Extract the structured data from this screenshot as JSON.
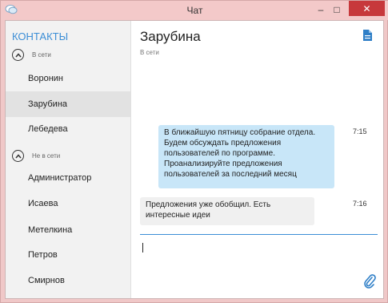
{
  "window": {
    "title": "Чат",
    "min_glyph": "–",
    "max_glyph": "□",
    "close_glyph": "✕"
  },
  "sidebar": {
    "title": "КОНТАКТЫ",
    "groups": [
      {
        "label": "В сети",
        "contacts": [
          "Воронин",
          "Зарубина",
          "Лебедева"
        ]
      },
      {
        "label": "Не в сети",
        "contacts": [
          "Администратор",
          "Исаева",
          "Метелкина",
          "Петров",
          "Смирнов"
        ]
      }
    ],
    "selected_contact": "Зарубина"
  },
  "chat": {
    "name": "Зарубина",
    "status": "В сети",
    "messages": [
      {
        "direction": "outgoing",
        "lines": [
          "В ближайшую пятницу собрание отдела.",
          "Будем обсуждать предложения",
          "пользователей по программе.",
          "Проанализируйте предложения",
          "пользователей за последний месяц"
        ],
        "time": "7:15"
      },
      {
        "direction": "incoming",
        "lines": [
          "Предложения уже обобщил. Есть",
          "интересные идеи"
        ],
        "time": "7:16"
      }
    ],
    "input_value": ""
  },
  "colors": {
    "accent": "#3c8ed6",
    "titlebar": "#f3c9c9",
    "close_button": "#c7383b",
    "outgoing_bubble": "#c8e6f8",
    "incoming_bubble": "#f0f0f0",
    "sidebar_bg": "#f2f2f2",
    "selected_bg": "#e2e2e2"
  },
  "icons": {
    "app": "chat-bubbles-icon",
    "document": "document-icon",
    "attach": "paperclip-icon",
    "group_toggle": "chevron-up-circle-icon"
  }
}
